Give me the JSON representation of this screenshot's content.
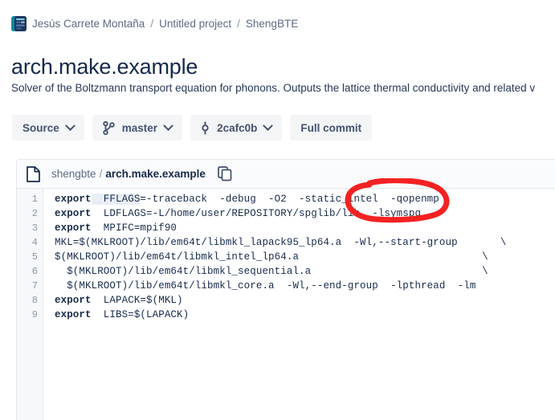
{
  "breadcrumb": {
    "icon": "project-avatar-icon",
    "items": [
      {
        "label": "Jesús Carrete Montaña"
      },
      {
        "label": "Untitled project"
      },
      {
        "label": "ShengBTE"
      }
    ],
    "separator": "/"
  },
  "page": {
    "title": "arch.make.example",
    "description": "Solver of the Boltzmann transport equation for phonons. Outputs the lattice thermal conductivity and related v"
  },
  "toolbar": {
    "source_label": "Source",
    "branch_label": "master",
    "branch_icon": "branch-icon",
    "commit_label": "2cafc0b",
    "commit_icon": "commit-icon",
    "full_commit_label": "Full commit"
  },
  "file_header": {
    "file_icon": "file-icon",
    "directory": "shengbte",
    "separator": "/",
    "filename": "arch.make.example",
    "copy_icon": "copy-icon"
  },
  "code": {
    "lines": [
      {
        "n": "1",
        "kw": "export",
        "rest": "  FFLAGS",
        "hl": true,
        "tail": "=-traceback  -debug  -O2  -static_intel  -qopenmp"
      },
      {
        "n": "2",
        "kw": "export",
        "rest": "  LDFLAGS=-L/home/user/REPOSITORY/spglib/lib  -lsymspg"
      },
      {
        "n": "3",
        "kw": "export",
        "rest": "  MPIFC=mpif90"
      },
      {
        "n": "4",
        "kw": "",
        "rest": "MKL=$(MKLROOT)/lib/em64t/libmkl_lapack95_lp64.a  -Wl,--start-group       \\"
      },
      {
        "n": "5",
        "kw": "",
        "rest": "$(MKLROOT)/lib/em64t/libmkl_intel_lp64.a                              \\"
      },
      {
        "n": "6",
        "kw": "",
        "rest": "  $(MKLROOT)/lib/em64t/libmkl_sequential.a                            \\"
      },
      {
        "n": "7",
        "kw": "",
        "rest": "  $(MKLROOT)/lib/em64t/libmkl_core.a  -Wl,--end-group  -lpthread  -lm"
      },
      {
        "n": "8",
        "kw": "export",
        "rest": "  LAPACK=$(MKL)"
      },
      {
        "n": "9",
        "kw": "export",
        "rest": "  LIBS=$(LAPACK)"
      }
    ]
  },
  "annotation": {
    "shape": "red-ellipse-highlight",
    "target_text": "-qopenmp",
    "color": "#f42222"
  },
  "colors": {
    "title": "#15294b",
    "muted": "#5d6b82",
    "button_bg": "#f4f5f7",
    "gutter_bg": "#f7f8fa",
    "border": "#e4e7ec",
    "annotation": "#f42222"
  }
}
